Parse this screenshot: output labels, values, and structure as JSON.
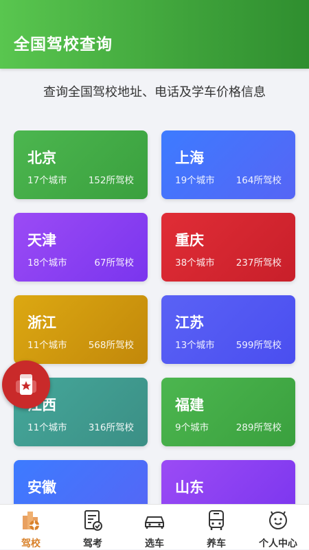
{
  "header": {
    "title": "全国驾校查询"
  },
  "subtitle": "查询全国驾校地址、电话及学车价格信息",
  "provinces": [
    {
      "name": "北京",
      "cities": "17个城市",
      "schools": "152所驾校",
      "color_from": "#4cb64f",
      "color_to": "#3aa03e"
    },
    {
      "name": "上海",
      "cities": "19个城市",
      "schools": "164所驾校",
      "color_from": "#3d7bff",
      "color_to": "#5665f5"
    },
    {
      "name": "天津",
      "cities": "18个城市",
      "schools": "67所驾校",
      "color_from": "#9b4bf5",
      "color_to": "#7a35ee"
    },
    {
      "name": "重庆",
      "cities": "38个城市",
      "schools": "237所驾校",
      "color_from": "#e02d36",
      "color_to": "#c81f2a"
    },
    {
      "name": "浙江",
      "cities": "11个城市",
      "schools": "568所驾校",
      "color_from": "#dca812",
      "color_to": "#c2880a"
    },
    {
      "name": "江苏",
      "cities": "13个城市",
      "schools": "599所驾校",
      "color_from": "#5a62f5",
      "color_to": "#4a4ef0"
    },
    {
      "name": "江西",
      "cities": "11个城市",
      "schools": "316所驾校",
      "color_from": "#45a79a",
      "color_to": "#3b8f85"
    },
    {
      "name": "福建",
      "cities": "9个城市",
      "schools": "289所驾校",
      "color_from": "#4cb64f",
      "color_to": "#3aa03e"
    },
    {
      "name": "安徽",
      "cities": "",
      "schools": "",
      "color_from": "#3d7bff",
      "color_to": "#5665f5"
    },
    {
      "name": "山东",
      "cities": "",
      "schools": "",
      "color_from": "#9b4bf5",
      "color_to": "#7a35ee"
    }
  ],
  "tabs": [
    {
      "label": "驾校",
      "icon": "driving-school-icon",
      "active": true
    },
    {
      "label": "驾考",
      "icon": "exam-icon",
      "active": false
    },
    {
      "label": "选车",
      "icon": "car-icon",
      "active": false
    },
    {
      "label": "养车",
      "icon": "bus-icon",
      "active": false
    },
    {
      "label": "个人中心",
      "icon": "profile-face-icon",
      "active": false
    }
  ],
  "colors": {
    "accent": "#d9822b",
    "header_green": "#4cb64f",
    "float_red": "#c92a2a"
  }
}
